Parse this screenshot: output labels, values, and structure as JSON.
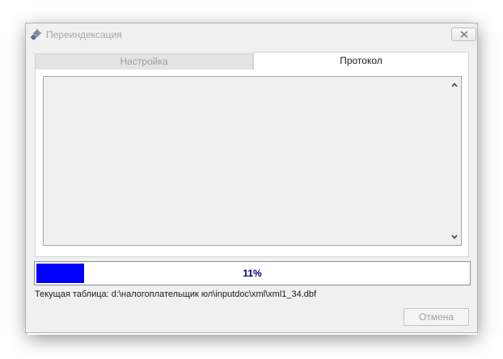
{
  "window": {
    "title": "Переиндексация",
    "icon": "gears-icon",
    "close_icon": "close-icon"
  },
  "tabs": [
    {
      "label": "Настройка",
      "active": false
    },
    {
      "label": "Протокол",
      "active": true
    }
  ],
  "log": {
    "lines": [],
    "scroll_up_icon": "chevron-up-icon",
    "scroll_down_icon": "chevron-down-icon"
  },
  "progress": {
    "percent": 11,
    "label": "11%",
    "fill_color": "#0000ff",
    "text_color": "#00007a"
  },
  "status": {
    "current_table": "Текущая таблица: d:\\налогоплательщик юл\\inputdoc\\xml\\xml1_34.dbf"
  },
  "buttons": {
    "cancel_label": "Отмена",
    "cancel_enabled": false
  }
}
